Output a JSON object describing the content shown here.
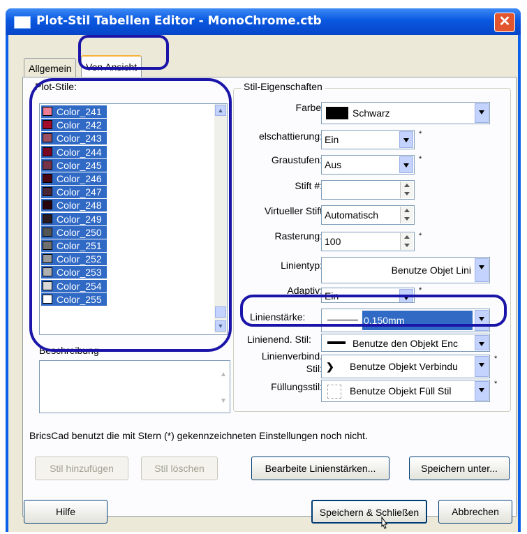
{
  "window": {
    "title": "Plot-Stil Tabellen Editor - MonoChrome.ctb"
  },
  "tabs": [
    {
      "label": "Allgemein"
    },
    {
      "label": "Von Ansicht"
    }
  ],
  "plot_styles": {
    "label": "Plot-Stile:",
    "items": [
      {
        "name": "Color_241",
        "color": "#ee7d93"
      },
      {
        "name": "Color_242",
        "color": "#a10c2a"
      },
      {
        "name": "Color_243",
        "color": "#9e5060"
      },
      {
        "name": "Color_244",
        "color": "#7c0522"
      },
      {
        "name": "Color_245",
        "color": "#763446"
      },
      {
        "name": "Color_246",
        "color": "#4c0612"
      },
      {
        "name": "Color_247",
        "color": "#4a2634"
      },
      {
        "name": "Color_248",
        "color": "#29050e"
      },
      {
        "name": "Color_249",
        "color": "#2a1b20"
      },
      {
        "name": "Color_250",
        "color": "#555555"
      },
      {
        "name": "Color_251",
        "color": "#707070"
      },
      {
        "name": "Color_252",
        "color": "#9a9a9a"
      },
      {
        "name": "Color_253",
        "color": "#b0b0b0"
      },
      {
        "name": "Color_254",
        "color": "#d8d8d8"
      },
      {
        "name": "Color_255",
        "color": "#ffffff"
      }
    ]
  },
  "description": {
    "label": "Beschreibung"
  },
  "properties": {
    "group_label": "Stil-Eigenschaften",
    "farbe": {
      "label": "Farbe:",
      "value": "Schwarz",
      "swatch": "#000000"
    },
    "schattierung": {
      "label": "elschattierung:",
      "value": "Ein"
    },
    "graustufen": {
      "label": "Graustufen:",
      "value": "Aus"
    },
    "stift": {
      "label": "Stift #:",
      "value": ""
    },
    "virtueller_stift": {
      "label": "Virtueller Stift",
      "value": "Automatisch"
    },
    "rasterung": {
      "label": "Rasterung:",
      "value": "100"
    },
    "linientyp": {
      "label": "Linientyp:",
      "value": "Benutze Objet Lini"
    },
    "adaptiv": {
      "label": "Adaptiv:",
      "value": "Ein"
    },
    "linienstaerke": {
      "label": "Linienstärke:",
      "value": "0.150mm"
    },
    "linienende": {
      "label": "Linienend. Stil:",
      "value": "Benutze den Objekt Enc"
    },
    "linienverbind": {
      "label1": "Linienverbind.",
      "label2": "Stil:",
      "value": "Benutze Objekt Verbindu"
    },
    "fuellung": {
      "label": "Füllungsstil:",
      "value": "Benutze Objekt Füll Stil"
    },
    "star": "*"
  },
  "note": "BricsCad benutzt die mit Stern (*) gekennzeichneten Einstellungen noch nicht.",
  "buttons": {
    "add_style": "Stil hinzufügen",
    "delete_style": "Stil löschen",
    "edit_lineweights": "Bearbeite Linienstärken...",
    "save_as": "Speichern unter...",
    "help": "Hilfe",
    "save_close": "Speichern & Schließen",
    "cancel": "Abbrechen"
  },
  "colors": {
    "title_bar": "#0a58e0",
    "highlight_ring": "#1a14a8",
    "selection": "#316ac5",
    "dialog_face": "#ece9d8"
  }
}
